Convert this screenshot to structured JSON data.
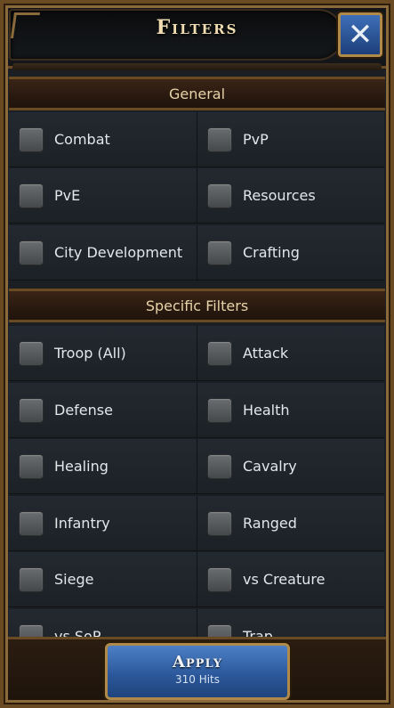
{
  "header": {
    "title": "Filters",
    "close_icon": "close-x-icon"
  },
  "sections": {
    "general": {
      "title": "General",
      "items": [
        "Combat",
        "PvP",
        "PvE",
        "Resources",
        "City Development",
        "Crafting"
      ]
    },
    "specific": {
      "title": "Specific Filters",
      "items": [
        "Troop (All)",
        "Attack",
        "Defense",
        "Health",
        "Healing",
        "Cavalry",
        "Infantry",
        "Ranged",
        "Siege",
        "vs Creature",
        "vs SoP",
        "Trap"
      ]
    }
  },
  "footer": {
    "apply_label": "Apply",
    "hits": "310 Hits"
  },
  "colors": {
    "accent_gold": "#b08a4a",
    "button_blue": "#2a5698"
  }
}
